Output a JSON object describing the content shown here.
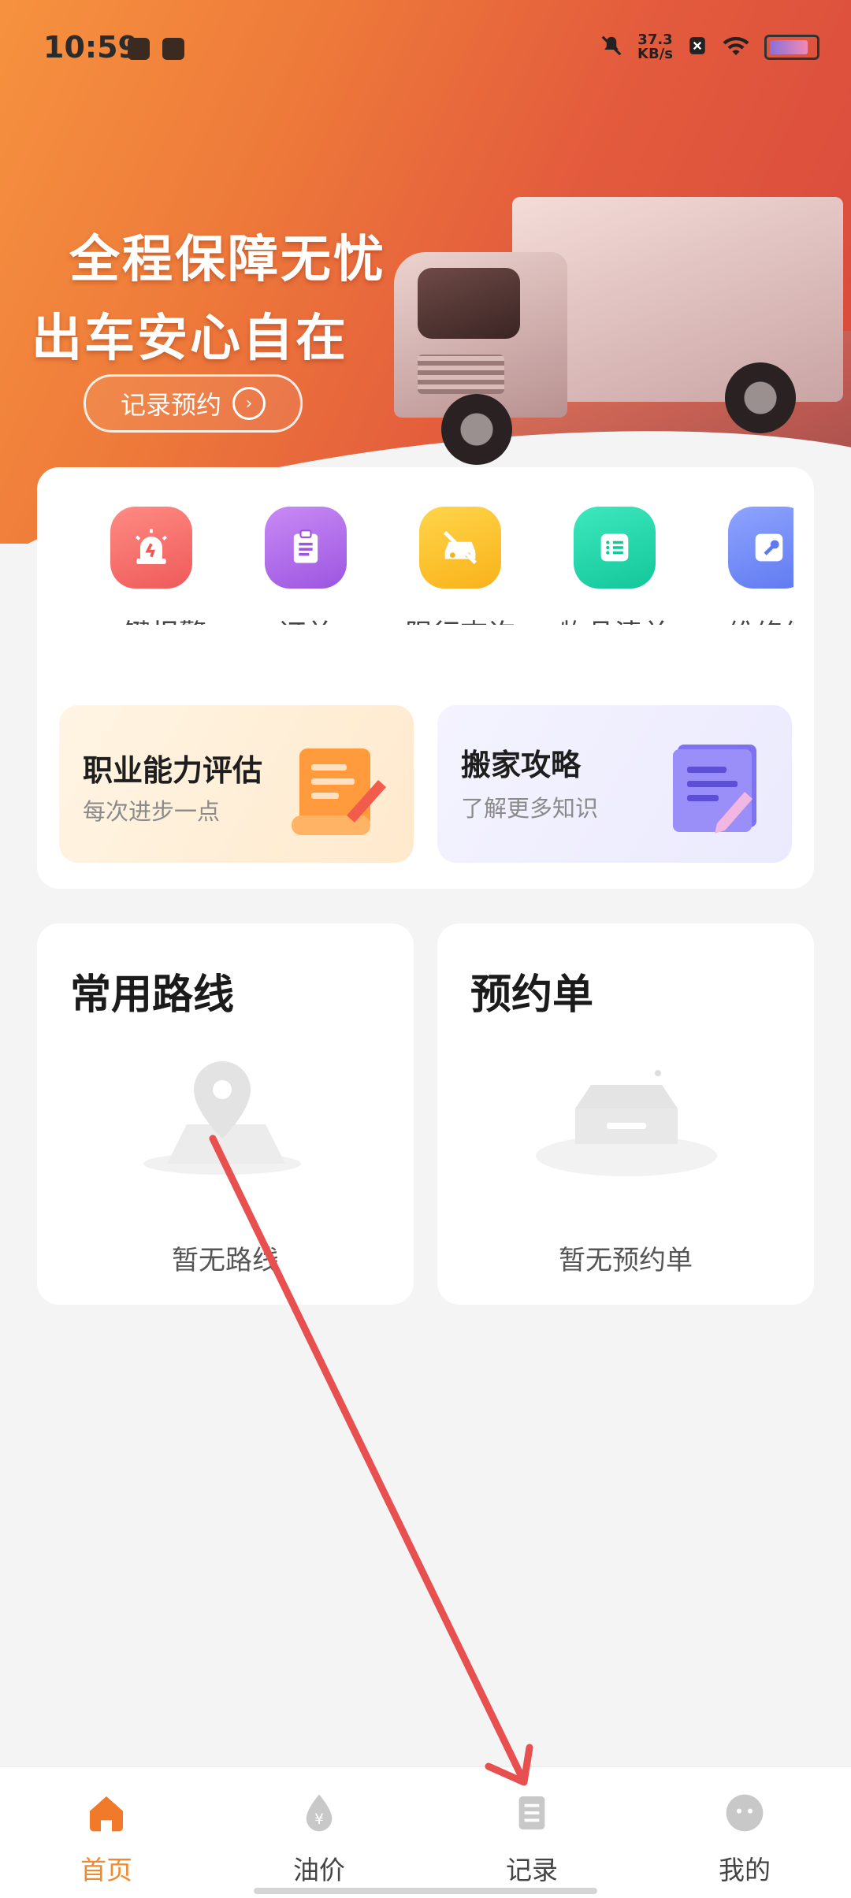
{
  "status_bar": {
    "time": "10:59",
    "net_speed_value": "37.3",
    "net_speed_unit": "KB/s"
  },
  "hero": {
    "title_line1": "全程保障无忧",
    "title_line2": "出车安心自在",
    "button_label": "记录预约"
  },
  "quick_actions": [
    {
      "label": "一键报警",
      "icon": "alarm-icon",
      "color": "#f26a6a"
    },
    {
      "label": "订单",
      "icon": "clipboard-icon",
      "color": "#b167e8"
    },
    {
      "label": "限行查询",
      "icon": "restricted-car-icon",
      "color": "#fcc22c"
    },
    {
      "label": "物品清单",
      "icon": "list-icon",
      "color": "#1fd2a6"
    },
    {
      "label": "维修保",
      "icon": "wrench-icon",
      "color": "#6b86f5"
    }
  ],
  "promos": [
    {
      "title": "职业能力评估",
      "subtitle": "每次进步一点"
    },
    {
      "title": "搬家攻略",
      "subtitle": "了解更多知识"
    }
  ],
  "cards": {
    "routes": {
      "title": "常用路线",
      "empty": "暂无路线"
    },
    "orders": {
      "title": "预约单",
      "empty": "暂无预约单"
    }
  },
  "tabs": [
    {
      "label": "首页",
      "icon": "home-icon",
      "active": true
    },
    {
      "label": "油价",
      "icon": "fuel-price-icon",
      "active": false
    },
    {
      "label": "记录",
      "icon": "record-icon",
      "active": false
    },
    {
      "label": "我的",
      "icon": "profile-icon",
      "active": false
    }
  ],
  "colors": {
    "accent": "#f08a2c",
    "hero_start": "#f6923f",
    "hero_end": "#d8473d",
    "annotation_arrow": "#e8504f"
  }
}
